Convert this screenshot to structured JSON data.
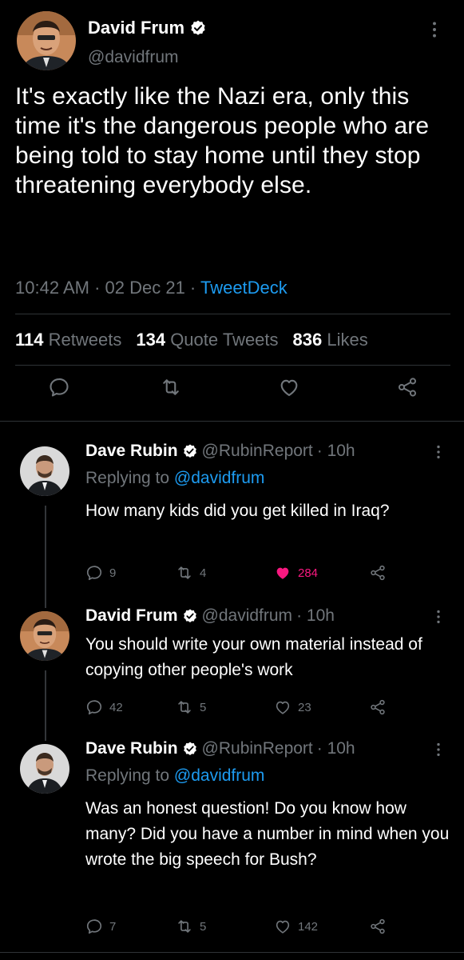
{
  "main_tweet": {
    "author_name": "David Frum",
    "author_handle": "@davidfrum",
    "verified": true,
    "text": "It's exactly like the Nazi era, only this time it's the dangerous people who are being told to stay home until they stop threatening everybody else.",
    "time": "10:42 AM",
    "sep1": " · ",
    "date": "02 Dec 21",
    "sep2": " · ",
    "source": "TweetDeck",
    "retweets_count": "114",
    "retweets_label": "Retweets",
    "quotes_count": "134",
    "quotes_label": "Quote Tweets",
    "likes_count": "836",
    "likes_label": "Likes",
    "actions": [
      "reply-icon",
      "retweet-icon",
      "like-icon",
      "share-icon"
    ]
  },
  "replies": [
    {
      "author_name": "Dave Rubin",
      "author_handle": "@RubinReport",
      "time": "· 10h",
      "replying_prefix": "Replying to",
      "replying_handle": "@davidfrum",
      "text": "How many kids did you get killed in Iraq?",
      "reply_count": "9",
      "retweet_count": "4",
      "like_count": "284",
      "liked": true
    },
    {
      "author_name": "David Frum",
      "author_handle": "@davidfrum",
      "time": "· 10h",
      "text": "You should write your own material instead of copying other people's work",
      "reply_count": "42",
      "retweet_count": "5",
      "like_count": "23",
      "liked": false
    },
    {
      "author_name": "Dave Rubin",
      "author_handle": "@RubinReport",
      "time": "· 10h",
      "replying_prefix": "Replying to",
      "replying_handle": "@davidfrum",
      "text": "Was an honest question! Do you know how many? Did you have a number in mind when you wrote the big speech for Bush?",
      "reply_count": "7",
      "retweet_count": "5",
      "like_count": "142",
      "liked": false
    }
  ],
  "colors": {
    "background": "#000000",
    "text": "#e7e9ea",
    "secondary": "#71767b",
    "link": "#1d9bf0",
    "like": "#f91880",
    "divider": "#2f3336"
  }
}
